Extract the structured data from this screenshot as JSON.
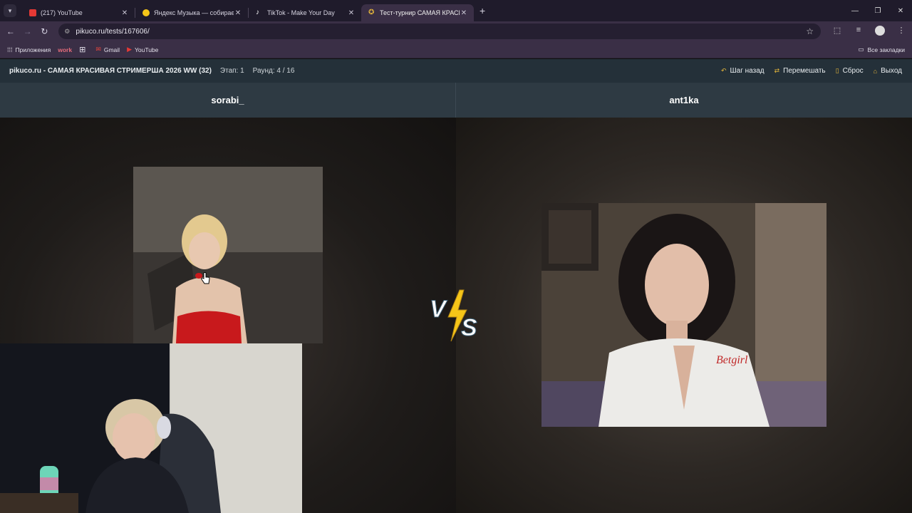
{
  "browser": {
    "tabs": [
      {
        "title": "(217) YouTube",
        "favicon_color": "#e53935",
        "active": false
      },
      {
        "title": "Яндекс Музыка — собираем м",
        "favicon_color": "#f5c518",
        "active": false
      },
      {
        "title": "TikTok - Make Your Day",
        "favicon_color": "#111111",
        "active": false
      },
      {
        "title": "Тест-турнир САМАЯ КРАСИВА",
        "favicon_color": "#e3b53b",
        "active": true
      }
    ],
    "url": "pikuco.ru/tests/167606/",
    "bookmarks": [
      {
        "label": "Приложения",
        "icon": "apps-icon"
      },
      {
        "label": "work",
        "icon": ""
      },
      {
        "label": "",
        "icon": "grid-icon"
      },
      {
        "label": "Gmail",
        "icon": "gmail-icon"
      },
      {
        "label": "YouTube",
        "icon": "youtube-icon"
      }
    ],
    "all_bookmarks": "Все закладки"
  },
  "header": {
    "title": "pikuco.ru - САМАЯ КРАСИВАЯ СТРИМЕРША 2026 WW (32)",
    "stage": "Этап: 1",
    "round": "Раунд: 4 / 16",
    "actions": {
      "back": "Шаг назад",
      "shuffle": "Перемешать",
      "reset": "Сброс",
      "exit": "Выход"
    }
  },
  "contestants": {
    "left": "sorabi_",
    "right": "ant1ka"
  },
  "vs_label": {
    "v": "V",
    "s": "S"
  },
  "colors": {
    "accent": "#e3b53b",
    "header_bg": "#243039",
    "names_bg": "#2e3a43",
    "browser_frame": "#3a2f46"
  }
}
